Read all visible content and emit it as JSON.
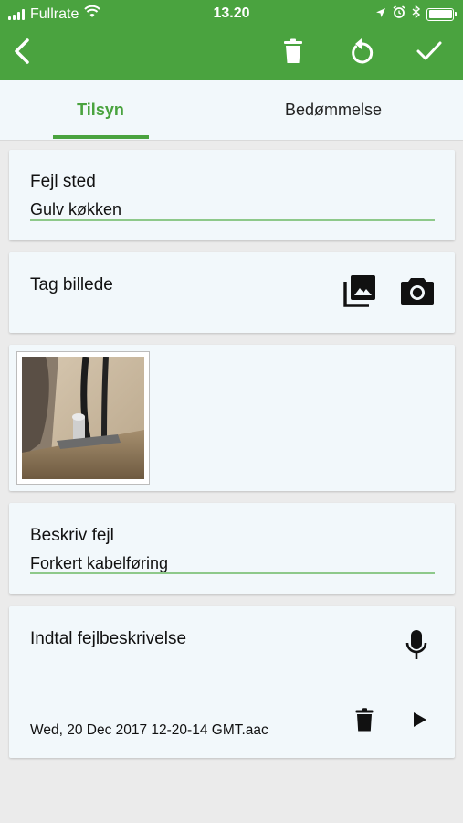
{
  "status_bar": {
    "carrier": "Fullrate",
    "time": "13.20"
  },
  "toolbar": {
    "back_icon": "arrow-back-icon",
    "delete_icon": "trash-icon",
    "reset_icon": "undo-icon",
    "confirm_icon": "checkmark-icon"
  },
  "tabs": [
    {
      "label": "Tilsyn",
      "active": true
    },
    {
      "label": "Bedømmelse",
      "active": false
    }
  ],
  "fault_location": {
    "label": "Fejl sted",
    "value": "Gulv køkken"
  },
  "photo": {
    "label": "Tag billede",
    "gallery_icon": "photo-library-icon",
    "camera_icon": "camera-icon"
  },
  "description": {
    "label": "Beskriv fejl",
    "value": "Forkert kabelføring"
  },
  "voice": {
    "label": "Indtal fejlbeskrivelse",
    "mic_icon": "microphone-icon",
    "file_name": "Wed, 20 Dec 2017 12-20-14 GMT.aac",
    "delete_icon": "trash-icon",
    "play_icon": "play-icon"
  },
  "colors": {
    "primary": "#4aa33f",
    "underline": "#8ec98a",
    "card_bg": "#f2f8fb",
    "page_bg": "#ebebeb"
  }
}
